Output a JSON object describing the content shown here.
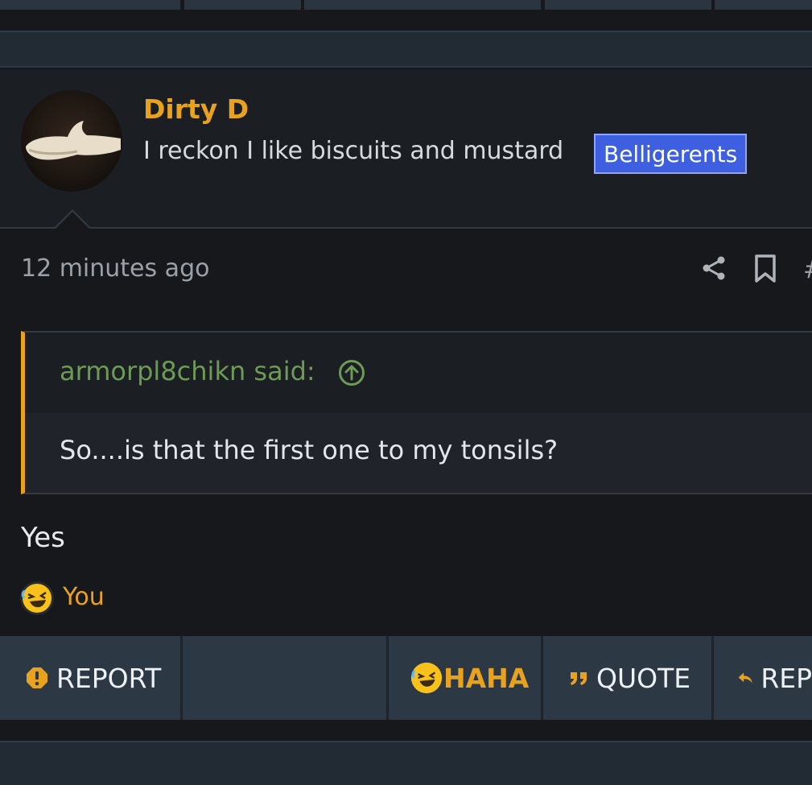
{
  "post": {
    "author": "Dirty D",
    "user_title": "I reckon I like biscuits and mustard",
    "user_badge": "Belligerents",
    "timestamp": "12 minutes ago",
    "post_number_prefix": "#"
  },
  "quote": {
    "author_line": "armorpl8chikn said:",
    "text": "So....is that the first one to my tonsils?"
  },
  "content": {
    "text": "Yes"
  },
  "reactions": {
    "summary": "You",
    "icon": "laughing-emoji-icon"
  },
  "actions": {
    "report": "REPORT",
    "haha": "HAHA",
    "quote": "QUOTE",
    "reply": "REP"
  },
  "colors": {
    "accent": "#e8a21e",
    "badge": "#3d5fe0",
    "quote_author": "#6d9a55"
  }
}
